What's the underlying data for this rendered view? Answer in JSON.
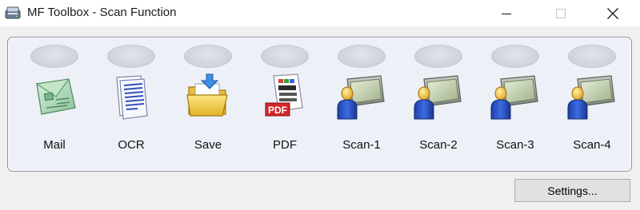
{
  "window": {
    "title": "MF Toolbox - Scan Function",
    "app_icon": "scanner-icon",
    "controls": {
      "minimize": "minimize-icon",
      "maximize": "maximize-icon",
      "close": "close-icon"
    }
  },
  "functions": [
    {
      "label": "Mail",
      "icon": "mail-icon"
    },
    {
      "label": "OCR",
      "icon": "ocr-document-icon"
    },
    {
      "label": "Save",
      "icon": "folder-save-icon"
    },
    {
      "label": "PDF",
      "icon": "pdf-icon"
    },
    {
      "label": "Scan-1",
      "icon": "scan-user-icon"
    },
    {
      "label": "Scan-2",
      "icon": "scan-user-icon"
    },
    {
      "label": "Scan-3",
      "icon": "scan-user-icon"
    },
    {
      "label": "Scan-4",
      "icon": "scan-user-icon"
    }
  ],
  "settings_button": {
    "label": "Settings..."
  }
}
